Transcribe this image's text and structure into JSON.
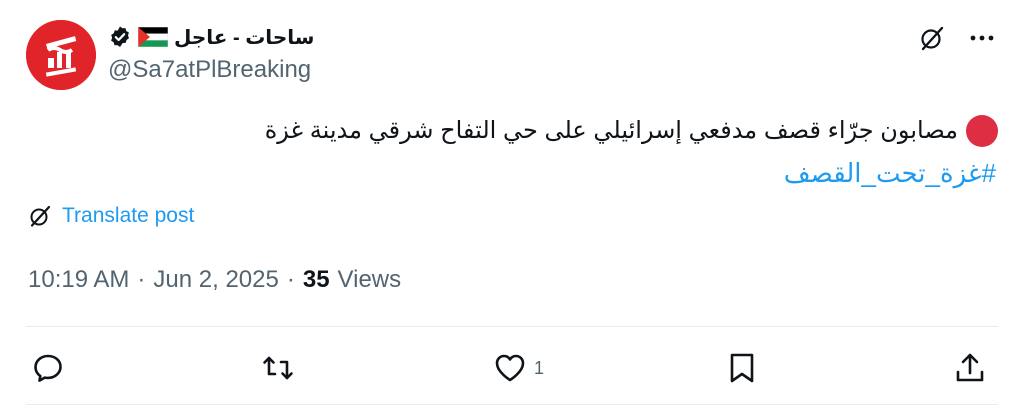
{
  "author": {
    "display_name": "ساحات - عاجل",
    "handle": "@Sa7atPlBreaking",
    "avatar": "sahat-logo-avatar",
    "verified": true,
    "flag": "palestine-flag"
  },
  "post": {
    "text": "مصابون جرّاء قصف مدفعي إسرائيلي على حي التفاح شرقي مدينة غزة",
    "hashtag": "#غزة_تحت_القصف",
    "translate_label": "Translate post",
    "time": "10:19 AM",
    "separator": "·",
    "date": "Jun 2, 2025",
    "views_count": "35",
    "views_label": "Views"
  },
  "actions": {
    "reply_count": "",
    "repost_count": "",
    "like_count": "1",
    "bookmark_count": ""
  },
  "icons": [
    "grok-icon",
    "more-icon",
    "reply-icon",
    "repost-icon",
    "like-icon",
    "bookmark-icon",
    "share-icon"
  ],
  "colors": {
    "accent": "#1d9bf0",
    "secondary_text": "#536471",
    "primary_text": "#0f1419",
    "avatar_bg": "#e0242a",
    "red_dot": "#dd2e44"
  }
}
